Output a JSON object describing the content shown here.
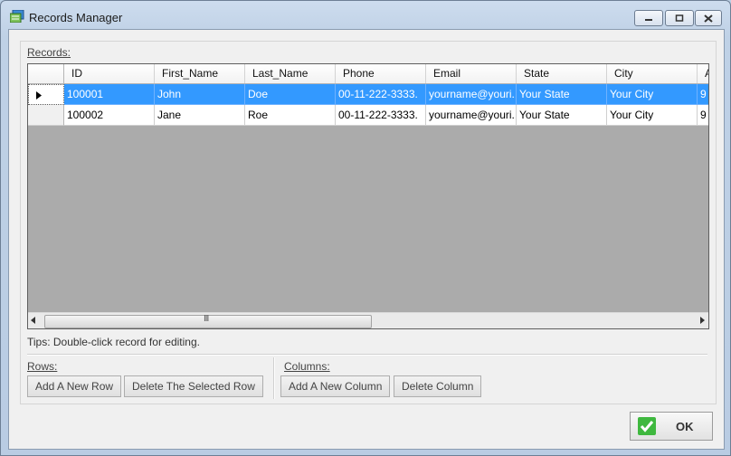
{
  "window": {
    "title": "Records Manager"
  },
  "records": {
    "label": "Records:",
    "columns": [
      "ID",
      "First_Name",
      "Last_Name",
      "Phone",
      "Email",
      "State",
      "City",
      "A"
    ],
    "rows": [
      [
        "100001",
        "John",
        "Doe",
        "00-11-222-3333.",
        "yourname@youri...",
        "Your State",
        "Your City",
        "9"
      ],
      [
        "100002",
        "Jane",
        "Roe",
        "00-11-222-3333.",
        "yourname@youri...",
        "Your State",
        "Your City",
        "9"
      ]
    ],
    "selected_row": 0
  },
  "tips": "Tips: Double-click record for editing.",
  "rows_group": {
    "label": "Rows:",
    "add_label": "Add A New Row",
    "delete_label": "Delete The Selected Row"
  },
  "columns_group": {
    "label": "Columns:",
    "add_label": "Add A New Column",
    "delete_label": "Delete Column"
  },
  "ok_label": "OK",
  "colors": {
    "selection": "#3399ff",
    "grid_empty": "#ababab",
    "ok_check": "#3fb83f"
  },
  "icons": [
    "records-app-icon",
    "minimize-icon",
    "maximize-icon",
    "close-icon",
    "row-pointer-icon",
    "scroll-left-icon",
    "scroll-right-icon",
    "checkmark-icon"
  ]
}
